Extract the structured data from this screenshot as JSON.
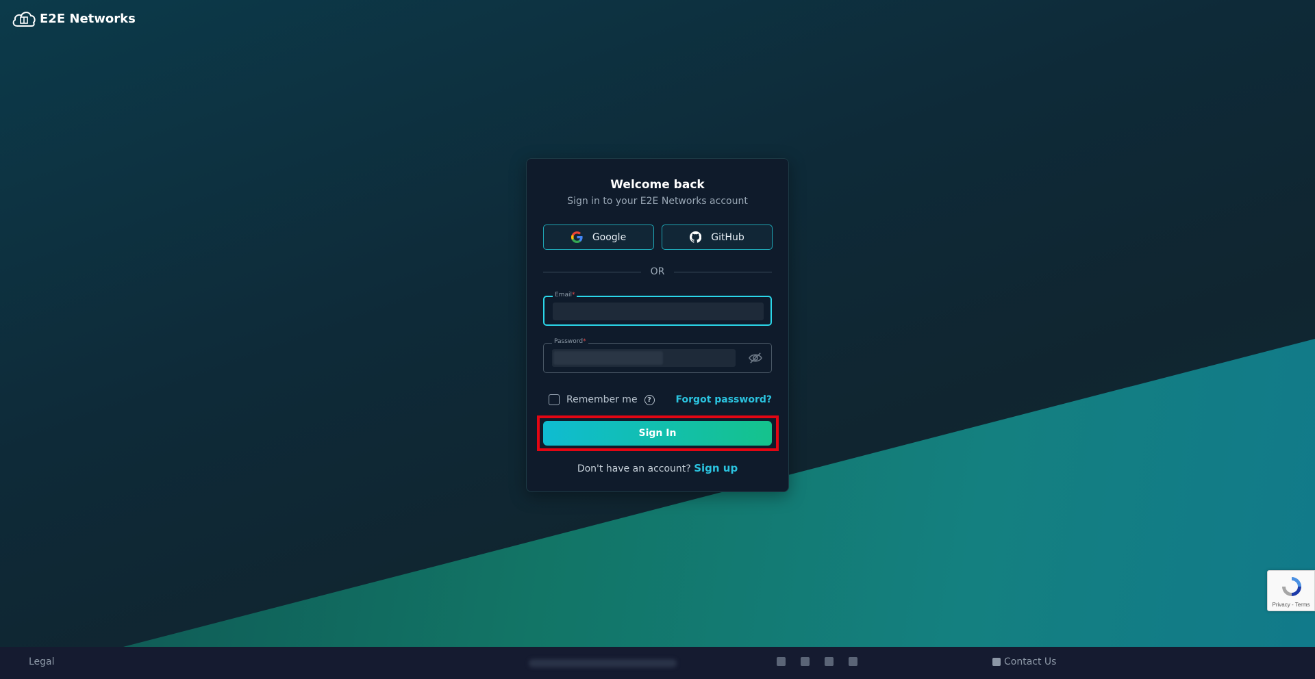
{
  "brand": {
    "name": "E2E Networks",
    "logo_icon": "cloud-logo-icon"
  },
  "login": {
    "title": "Welcome back",
    "subtitle": "Sign in to your E2E Networks account",
    "google_label": "Google",
    "github_label": "GitHub",
    "divider_label": "OR",
    "email": {
      "label": "Email",
      "required_mark": "*",
      "value": ""
    },
    "password": {
      "label": "Password",
      "required_mark": "*",
      "value": ""
    },
    "remember_label": "Remember me",
    "forgot_label": "Forgot password?",
    "signin_label": "Sign In",
    "signup_prompt": "Don't have an account?",
    "signup_label": "Sign up"
  },
  "recaptcha": {
    "terms": "Privacy - Terms"
  },
  "footer": {
    "legal": "Legal",
    "contact": "Contact Us",
    "social_icons": [
      "linkedin-icon",
      "facebook-icon",
      "twitter-icon",
      "rss-icon"
    ]
  },
  "colors": {
    "accent": "#2bc4e0",
    "button_start": "#0fbcd1",
    "button_end": "#15c28c",
    "highlight": "#e30613"
  }
}
